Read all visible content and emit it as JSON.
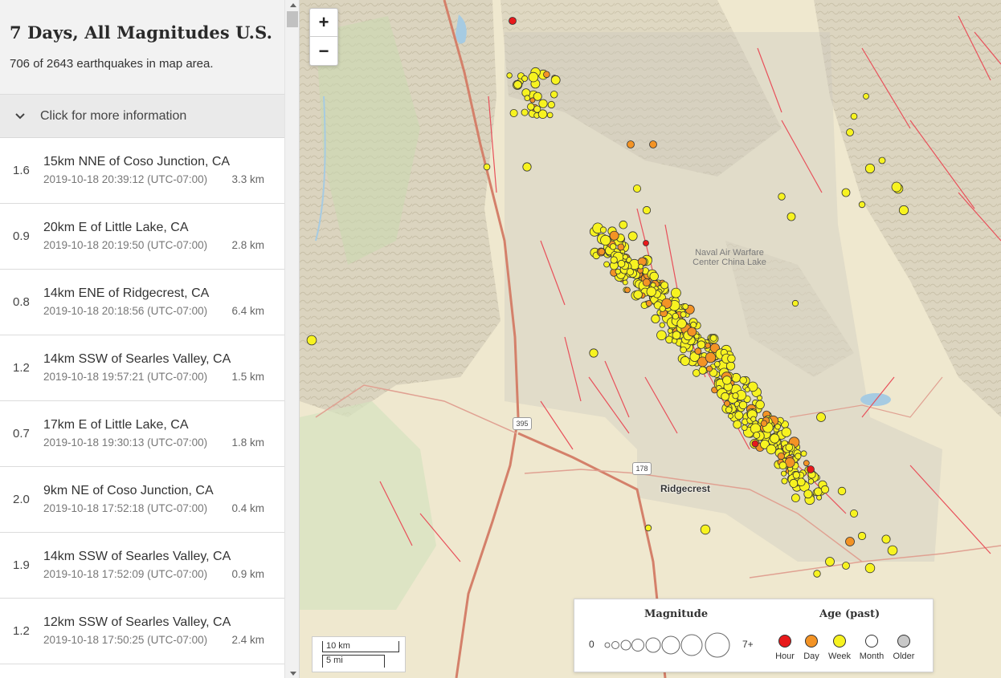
{
  "sidebar": {
    "title": "7 Days, All Magnitudes U.S.",
    "count_text": "706 of 2643 earthquakes in map area.",
    "more_info_label": "Click for more information"
  },
  "quakes": [
    {
      "mag": "1.6",
      "place": "15km NNE of Coso Junction, CA",
      "time": "2019-10-18 20:39:12 (UTC-07:00)",
      "depth": "3.3 km"
    },
    {
      "mag": "0.9",
      "place": "20km E of Little Lake, CA",
      "time": "2019-10-18 20:19:50 (UTC-07:00)",
      "depth": "2.8 km"
    },
    {
      "mag": "0.8",
      "place": "14km ENE of Ridgecrest, CA",
      "time": "2019-10-18 20:18:56 (UTC-07:00)",
      "depth": "6.4 km"
    },
    {
      "mag": "1.2",
      "place": "14km SSW of Searles Valley, CA",
      "time": "2019-10-18 19:57:21 (UTC-07:00)",
      "depth": "1.5 km"
    },
    {
      "mag": "0.7",
      "place": "17km E of Little Lake, CA",
      "time": "2019-10-18 19:30:13 (UTC-07:00)",
      "depth": "1.8 km"
    },
    {
      "mag": "2.0",
      "place": "9km NE of Coso Junction, CA",
      "time": "2019-10-18 17:52:18 (UTC-07:00)",
      "depth": "0.4 km"
    },
    {
      "mag": "1.9",
      "place": "14km SSW of Searles Valley, CA",
      "time": "2019-10-18 17:52:09 (UTC-07:00)",
      "depth": "0.9 km"
    },
    {
      "mag": "1.2",
      "place": "12km SSW of Searles Valley, CA",
      "time": "2019-10-18 17:50:25 (UTC-07:00)",
      "depth": "2.4 km"
    }
  ],
  "map": {
    "zoom_in": "+",
    "zoom_out": "−",
    "area_label_line1": "Naval Air Warfare",
    "area_label_line2": "Center China Lake",
    "city_label": "Ridgecrest",
    "shield_395": "395",
    "shield_178": "178",
    "scale_km": "10 km",
    "scale_mi": "5 mi"
  },
  "legend": {
    "magnitude_title": "Magnitude",
    "age_title": "Age (past)",
    "min_label": "0",
    "max_label": "7+",
    "ages": [
      {
        "label": "Hour",
        "color": "#e8191b"
      },
      {
        "label": "Day",
        "color": "#f39325"
      },
      {
        "label": "Week",
        "color": "#f7f320"
      },
      {
        "label": "Month",
        "color": "#ffffff"
      },
      {
        "label": "Older",
        "color": "#c8c8c8"
      }
    ]
  },
  "colors": {
    "hour": "#e8191b",
    "day": "#f39325",
    "week": "#f7f320",
    "fault_line": "#e8505a",
    "highway": "#d4806a"
  }
}
